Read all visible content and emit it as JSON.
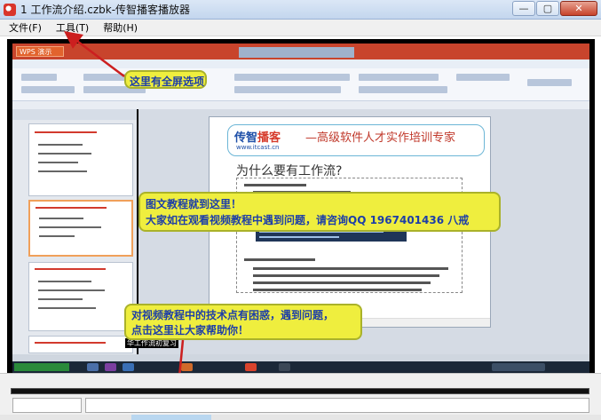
{
  "window": {
    "title": "1 工作流介绍.czbk-传智播客播放器",
    "minimize_glyph": "—",
    "restore_glyph": "▢",
    "close_glyph": "✕"
  },
  "menu": {
    "items": [
      "文件(F)",
      "工具(T)",
      "帮助(H)"
    ]
  },
  "video": {
    "wps_badge": "WPS 演示",
    "slide": {
      "logo_part1": "传智",
      "logo_part2": "播客",
      "url": "www.itcast.cn",
      "slogan": "—高级软件人才实作培训专家",
      "title": "为什么要有工作流?"
    },
    "caption": "华工作流初复习"
  },
  "callouts": {
    "fullscreen": "这里有全屏选项",
    "notice_line1": "图文教程就到这里！",
    "notice_line2": "大家如在观看视频教程中遇到问题，请咨询QQ 1967401436 八戒",
    "help_line1": "对视频教程中的技术点有困惑，遇到问题，",
    "help_line2": "点击这里让大家帮助你！"
  },
  "colors": {
    "callout_bg": "#efee3e",
    "callout_text": "#1d3ea8",
    "arrow": "#cc1f1f",
    "wps_red": "#c8442c"
  }
}
